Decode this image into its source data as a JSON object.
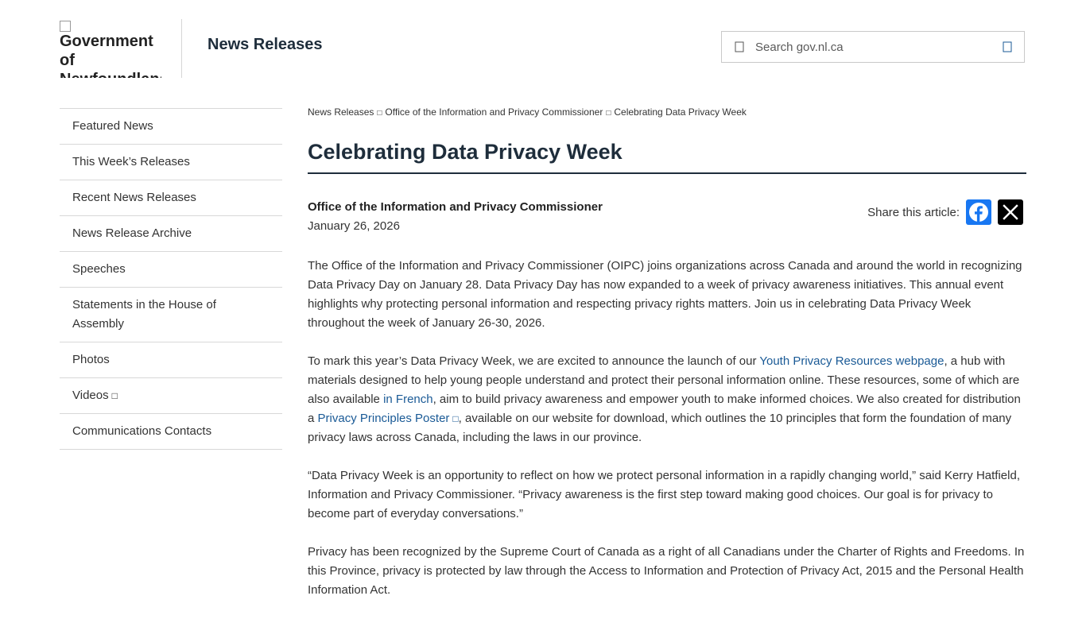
{
  "header": {
    "logo_alt": "Government of Newfoundland and Labrador",
    "site_title": "News Releases",
    "search_placeholder": "Search gov.nl.ca"
  },
  "sidebar": {
    "items": [
      {
        "label": "Featured News"
      },
      {
        "label": "This Week’s Releases"
      },
      {
        "label": "Recent News Releases"
      },
      {
        "label": "News Release Archive"
      },
      {
        "label": "Speeches"
      },
      {
        "label": "Statements in the House of Assembly"
      },
      {
        "label": "Photos"
      },
      {
        "label": "Videos"
      },
      {
        "label": "Communications Contacts"
      }
    ]
  },
  "breadcrumb": {
    "items": [
      "News Releases",
      "Office of the Information and Privacy Commissioner",
      "Celebrating Data Privacy Week"
    ]
  },
  "article": {
    "title": "Celebrating Data Privacy Week",
    "department": "Office of the Information and Privacy Commissioner",
    "date": "January 26, 2026",
    "share_label": "Share this article:",
    "p1": "The Office of the Information and Privacy Commissioner (OIPC) joins organizations across Canada and around the world in recognizing Data Privacy Day on January 28. Data Privacy Day has now expanded to a week of privacy awareness initiatives. This annual event highlights why protecting personal information and respecting privacy rights matters. Join us in celebrating Data Privacy Week throughout the week of January 26-30, 2026.",
    "p2_a": "To mark this year’s Data Privacy Week, we are excited to announce the launch of our ",
    "p2_link1": "Youth Privacy Resources webpage",
    "p2_b": ", a hub with materials designed to help young people understand and protect their personal information online. These resources, some of which are also available ",
    "p2_link2": "in French",
    "p2_c": ", aim to build privacy awareness and empower youth to make informed choices. We also created for distribution a ",
    "p2_link3": "Privacy Principles Poster",
    "p2_d": ", available on our website for download, which outlines the 10 principles that form the foundation of many privacy laws across Canada, including the laws in our province.",
    "p3": "“Data Privacy Week is an opportunity to reflect on how we protect personal information in a rapidly changing world,” said Kerry Hatfield, Information and Privacy Commissioner. “Privacy awareness is the first step toward making good choices. Our goal is for privacy to become part of everyday conversations.”",
    "p4": "Privacy has been recognized by the Supreme Court of Canada as a right of all Canadians under the Charter of Rights and Freedoms. In this Province, privacy is protected by law through the Access to Information and Protection of Privacy Act, 2015 and the Personal Health Information Act."
  },
  "colors": {
    "heading": "#1e2d3b",
    "link": "#1a5a96",
    "facebook": "#1877f2",
    "x": "#000000"
  },
  "icons": [
    "broken-image-icon",
    "search-icon",
    "search-submit-icon",
    "chevron-right-icon",
    "external-link-icon",
    "facebook-icon",
    "x-icon"
  ]
}
